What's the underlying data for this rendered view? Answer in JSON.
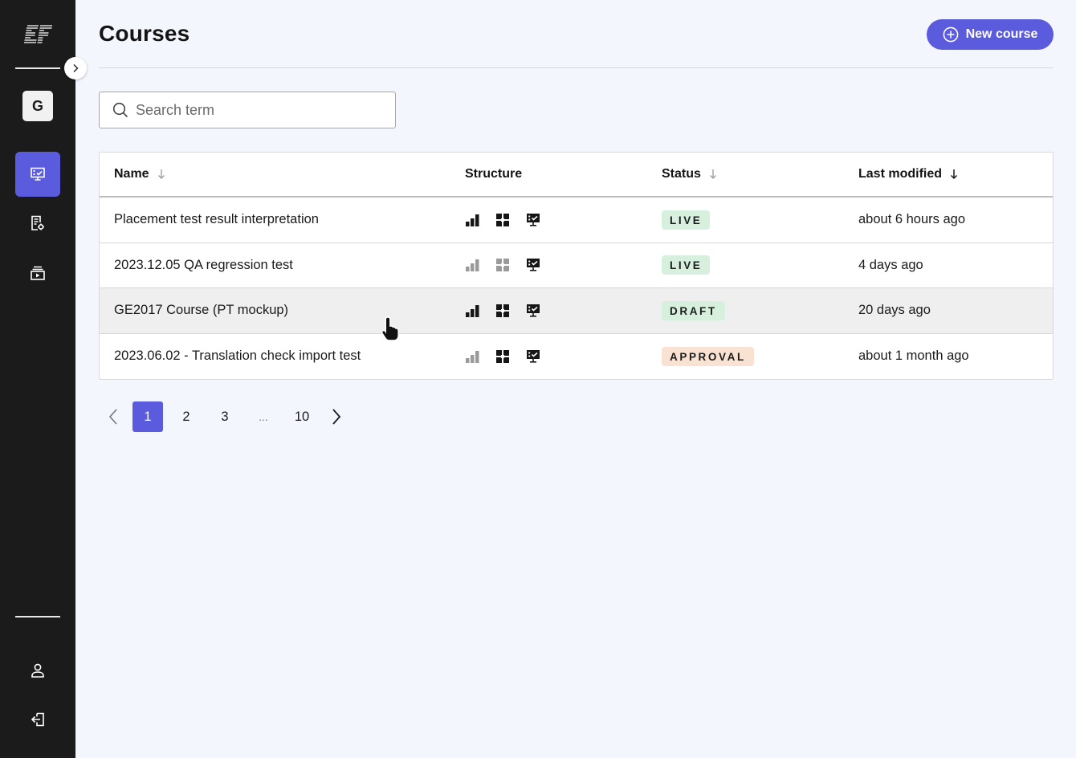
{
  "app": {
    "logo_text": "EF",
    "workspace_initial": "G",
    "accent_color": "#5b5bde"
  },
  "sidebar": {
    "collapse_icon": "chevron-right-icon",
    "nav_items": [
      {
        "name": "courses",
        "icon": "monitor-check-icon",
        "active": true
      },
      {
        "name": "reports",
        "icon": "document-gear-icon",
        "active": false
      },
      {
        "name": "media",
        "icon": "media-library-icon",
        "active": false
      }
    ],
    "bottom_items": [
      {
        "name": "profile",
        "icon": "user-icon"
      },
      {
        "name": "logout",
        "icon": "logout-icon"
      }
    ]
  },
  "header": {
    "title": "Courses",
    "new_course_label": "New course",
    "new_course_icon": "plus-circle-icon"
  },
  "search": {
    "placeholder": "Search term",
    "value": ""
  },
  "table": {
    "columns": [
      {
        "label": "Name",
        "sort": "sort-arrow-down-icon",
        "sort_active": false
      },
      {
        "label": "Structure"
      },
      {
        "label": "Status",
        "sort": "sort-arrow-down-icon",
        "sort_active": false
      },
      {
        "label": "Last modified",
        "sort": "sort-arrow-down-icon",
        "sort_active": true
      }
    ],
    "rows": [
      {
        "name": "Placement test result interpretation",
        "structure": {
          "levels": "active",
          "modules": "active",
          "lessons": "active"
        },
        "status": "LIVE",
        "status_type": "live",
        "last_modified": "about 6 hours ago"
      },
      {
        "name": "2023.12.05 QA regression test",
        "structure": {
          "levels": "inactive",
          "modules": "inactive",
          "lessons": "active"
        },
        "status": "LIVE",
        "status_type": "live",
        "last_modified": "4 days ago"
      },
      {
        "name": "GE2017 Course (PT mockup)",
        "structure": {
          "levels": "active",
          "modules": "active",
          "lessons": "active"
        },
        "status": "DRAFT",
        "status_type": "live",
        "last_modified": "20 days ago",
        "hovered": true
      },
      {
        "name": "2023.06.02 - Translation check import test",
        "structure": {
          "levels": "inactive",
          "modules": "active",
          "lessons": "active"
        },
        "status": "APPROVAL",
        "status_type": "approval",
        "last_modified": "about 1 month ago"
      }
    ]
  },
  "pagination": {
    "prev_icon": "chevron-left-icon",
    "next_icon": "chevron-right-icon",
    "pages": [
      "1",
      "2",
      "3",
      "...",
      "10"
    ],
    "current": "1"
  },
  "colors": {
    "live_badge": "#d7f0de",
    "approval_badge": "#f9e2d2",
    "sidebar_bg": "#1b1b1b",
    "page_bg": "#f3f6fc"
  }
}
